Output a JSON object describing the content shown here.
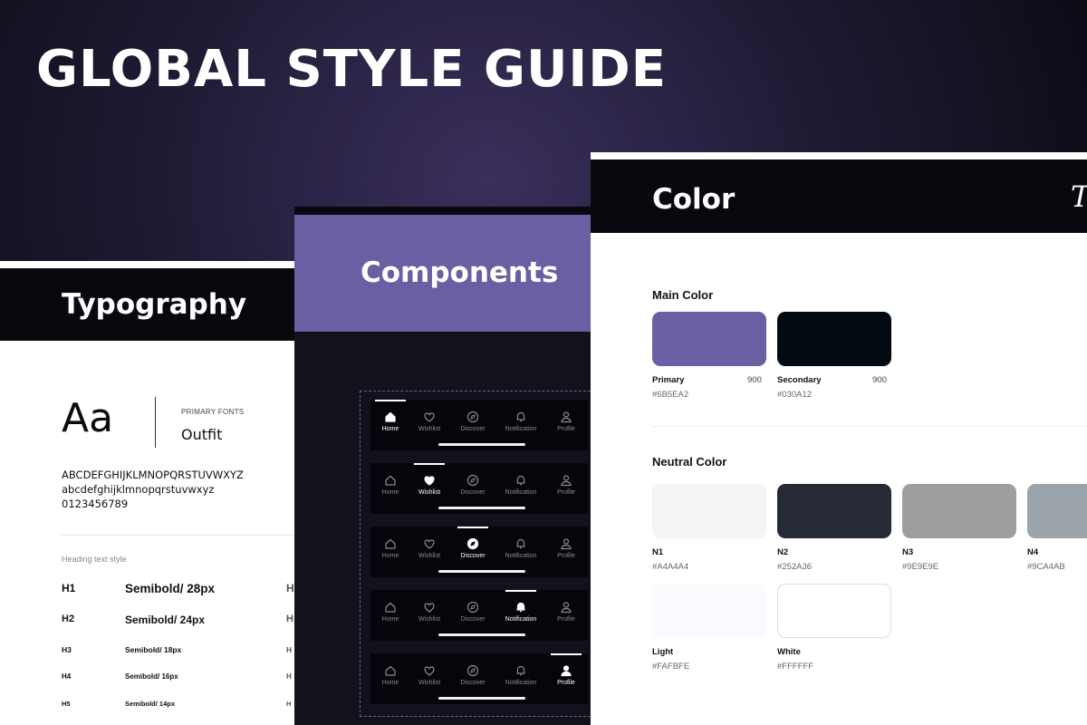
{
  "title": "GLOBAL STYLE GUIDE",
  "typography": {
    "header": "Typography",
    "sample": "Aa",
    "primary_fonts_label": "PRIMARY FONTS",
    "font_name": "Outfit",
    "uppercase": "ABCDEFGHIJKLMNOPQRSTUVWXYZ",
    "lowercase": "abcdefghijklmnopqrstuvwxyz",
    "digits": "0123456789",
    "heading_style_label": "Heading text style",
    "headings": [
      {
        "level": "H1",
        "spec": "Semibold/ 28px",
        "ghost": "H"
      },
      {
        "level": "H2",
        "spec": "Semibold/ 24px",
        "ghost": "H"
      },
      {
        "level": "H3",
        "spec": "Semibold/ 18px",
        "ghost": "H"
      },
      {
        "level": "H4",
        "spec": "Semibold/ 16px",
        "ghost": "H"
      },
      {
        "level": "H5",
        "spec": "Semibold/ 14px",
        "ghost": "H"
      }
    ]
  },
  "components": {
    "header": "Components",
    "nav_labels": [
      "Home",
      "Wishlist",
      "Discover",
      "Notification",
      "Profile"
    ],
    "nav_icons": [
      "home-icon",
      "heart-icon",
      "compass-icon",
      "bell-icon",
      "user-icon"
    ],
    "active_index_per_bar": [
      0,
      1,
      2,
      3,
      4
    ]
  },
  "color": {
    "header": "Color",
    "header_peek": "T",
    "main_title": "Main Color",
    "main": [
      {
        "name": "Primary",
        "weight": "900",
        "hex": "#6B5EA2",
        "color": "#6B5EA2"
      },
      {
        "name": "Secondary",
        "weight": "900",
        "hex": "#030A12",
        "color": "#030A12"
      }
    ],
    "neutral_title": "Neutral Color",
    "neutral": [
      {
        "name": "N1",
        "hex": "#A4A4A4",
        "color": "#F4F4F4"
      },
      {
        "name": "N2",
        "hex": "#252A36",
        "color": "#252A36"
      },
      {
        "name": "N3",
        "hex": "#9E9E9E",
        "color": "#9E9E9E"
      },
      {
        "name": "N4",
        "hex": "#9CA4AB",
        "color": "#9CA4AB"
      },
      {
        "name": "Light",
        "hex": "#FAFBFE",
        "color": "#FAFBFE"
      },
      {
        "name": "White",
        "hex": "#FFFFFF",
        "color": "#FFFFFF"
      }
    ]
  }
}
